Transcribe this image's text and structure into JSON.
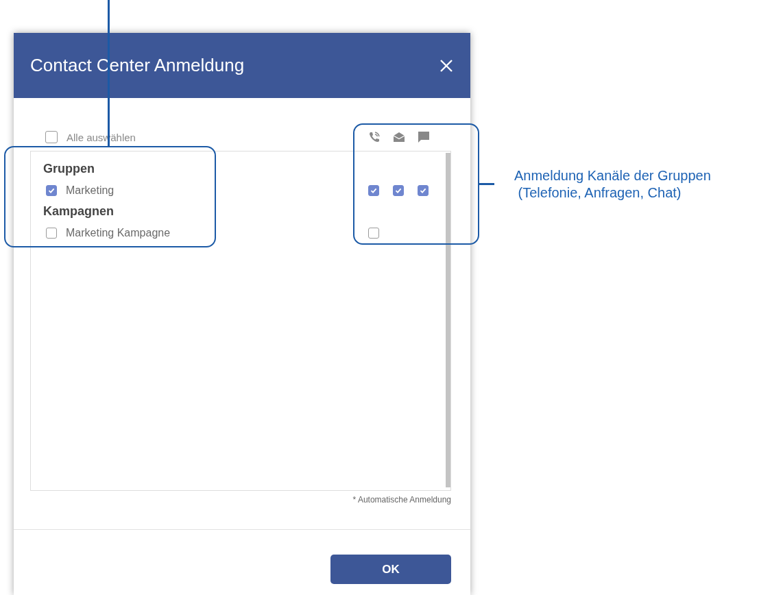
{
  "dialog": {
    "title": "Contact Center Anmeldung",
    "select_all": {
      "label": "Alle auswählen",
      "checked": false
    },
    "sections": [
      {
        "heading": "Gruppen",
        "items": [
          {
            "label": "Marketing",
            "checked": true,
            "channels": [
              {
                "checked": true
              },
              {
                "checked": true
              },
              {
                "checked": true
              }
            ]
          }
        ]
      },
      {
        "heading": "Kampagnen",
        "items": [
          {
            "label": "Marketing Kampagne",
            "checked": false,
            "channels": [
              {
                "checked": false
              }
            ]
          }
        ]
      }
    ],
    "footnote": "* Automatische Anmeldung",
    "buttons": [
      "OK"
    ]
  },
  "annotation": {
    "lines": [
      "Anmeldung Kanäle der Gruppen",
      " (Telefonie, Anfragen, Chat)"
    ]
  }
}
